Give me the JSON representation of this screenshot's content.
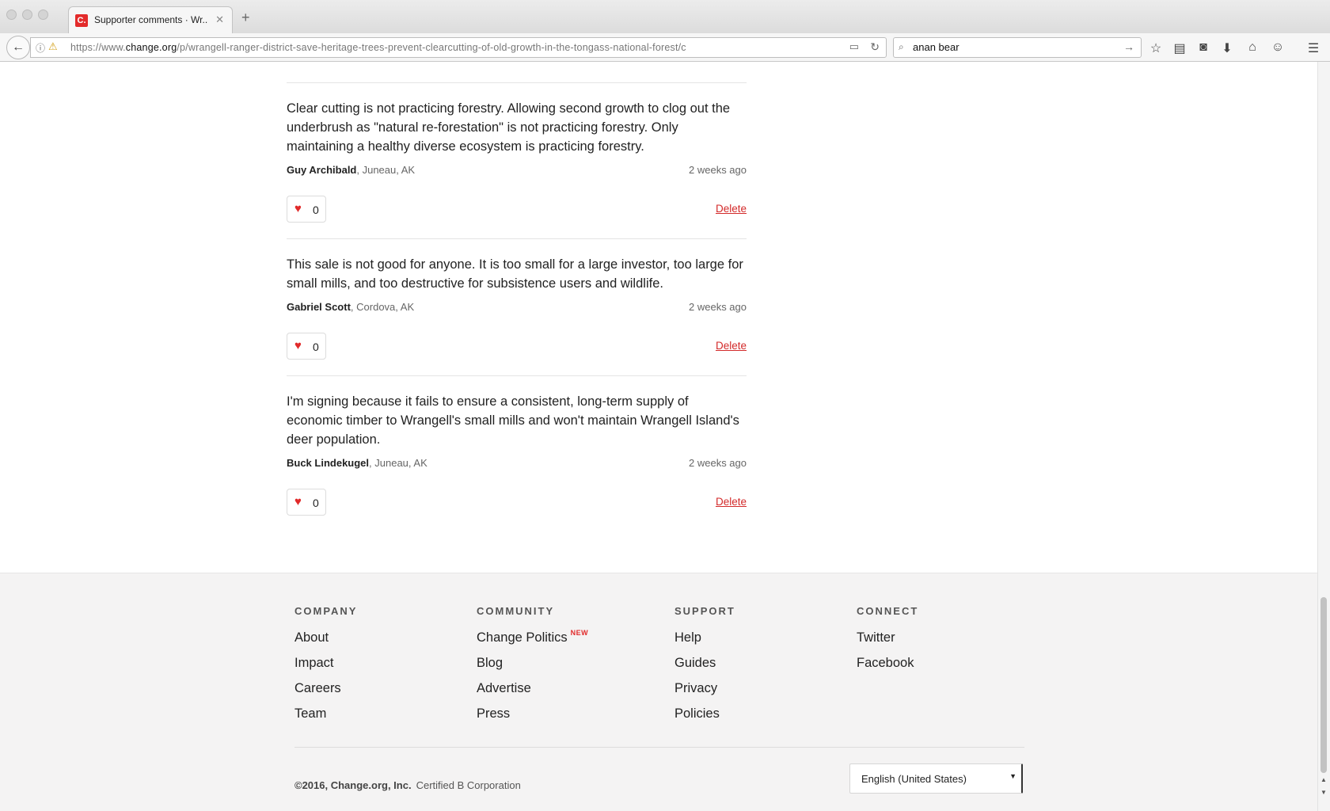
{
  "browser": {
    "tab_title": "Supporter comments · Wr...",
    "favicon_label": "C.",
    "url_prefix": "https://www.",
    "url_domain": "change.org",
    "url_path": "/p/wrangell-ranger-district-save-heritage-trees-prevent-clearcutting-of-old-growth-in-the-tongass-national-forest/c",
    "search_value": "anan bear"
  },
  "comments": [
    {
      "body": "Clear cutting is not practicing forestry. Allowing second growth to clog out the underbrush as \"natural re-forestation\" is not practicing forestry. Only maintaining a healthy diverse ecosystem is practicing forestry.",
      "author": "Guy Archibald",
      "location": ", Juneau, AK",
      "time": "2 weeks ago",
      "likes": "0",
      "delete_label": "Delete"
    },
    {
      "body": "This sale is not good for anyone. It is too small for a large investor, too large for small mills, and too destructive for subsistence users and wildlife.",
      "author": "Gabriel Scott",
      "location": ", Cordova, AK",
      "time": "2 weeks ago",
      "likes": "0",
      "delete_label": "Delete"
    },
    {
      "body": "I'm signing because it fails to ensure a consistent, long-term supply of economic timber to Wrangell's small mills and won't maintain Wrangell Island's deer population.",
      "author": "Buck Lindekugel",
      "location": ", Juneau, AK",
      "time": "2 weeks ago",
      "likes": "0",
      "delete_label": "Delete"
    }
  ],
  "footer": {
    "company": {
      "heading": "COMPANY",
      "links": [
        "About",
        "Impact",
        "Careers",
        "Team"
      ]
    },
    "community": {
      "heading": "COMMUNITY",
      "links": [
        "Change Politics",
        "Blog",
        "Advertise",
        "Press"
      ],
      "new_badge": "NEW"
    },
    "support": {
      "heading": "SUPPORT",
      "links": [
        "Help",
        "Guides",
        "Privacy",
        "Policies"
      ]
    },
    "connect": {
      "heading": "CONNECT",
      "links": [
        "Twitter",
        "Facebook"
      ]
    },
    "copyright": "©2016, Change.org, Inc.",
    "certified": "Certified B Corporation",
    "language": "English (United States)"
  },
  "colors": {
    "accent": "#e12a2a",
    "footer_bg": "#f4f3f3"
  },
  "icons": [
    "back-arrow-icon",
    "info-icon",
    "warning-lock-icon",
    "reader-view-icon",
    "reload-icon",
    "search-icon",
    "go-arrow-icon",
    "bookmark-star-icon",
    "library-icon",
    "pocket-icon",
    "download-icon",
    "home-icon",
    "chat-icon",
    "menu-icon",
    "heart-icon"
  ]
}
